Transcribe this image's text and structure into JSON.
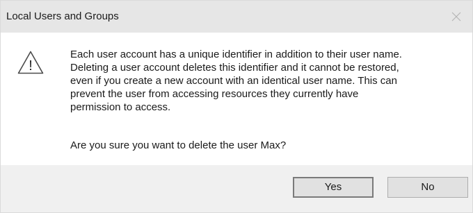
{
  "window": {
    "title": "Local Users and Groups",
    "close_glyph": "✕"
  },
  "message": {
    "lines": [
      "Each user account has a unique identifier in addition to their user name.",
      "Deleting a user account deletes this identifier and it cannot be restored,",
      "even if you create a new account with an identical user name. This can",
      "prevent the user from accessing resources they currently have",
      "permission to access."
    ],
    "question": "Are you sure you want to delete the user Max?"
  },
  "icon": {
    "name": "warning-icon",
    "glyph": "!"
  },
  "buttons": {
    "yes_label": "Yes",
    "no_label": "No"
  },
  "colors": {
    "titlebar": "#e6e6e6",
    "footer": "#f0f0f0",
    "button_face": "#e1e1e1",
    "default_button_border": "#7a7a7a"
  }
}
